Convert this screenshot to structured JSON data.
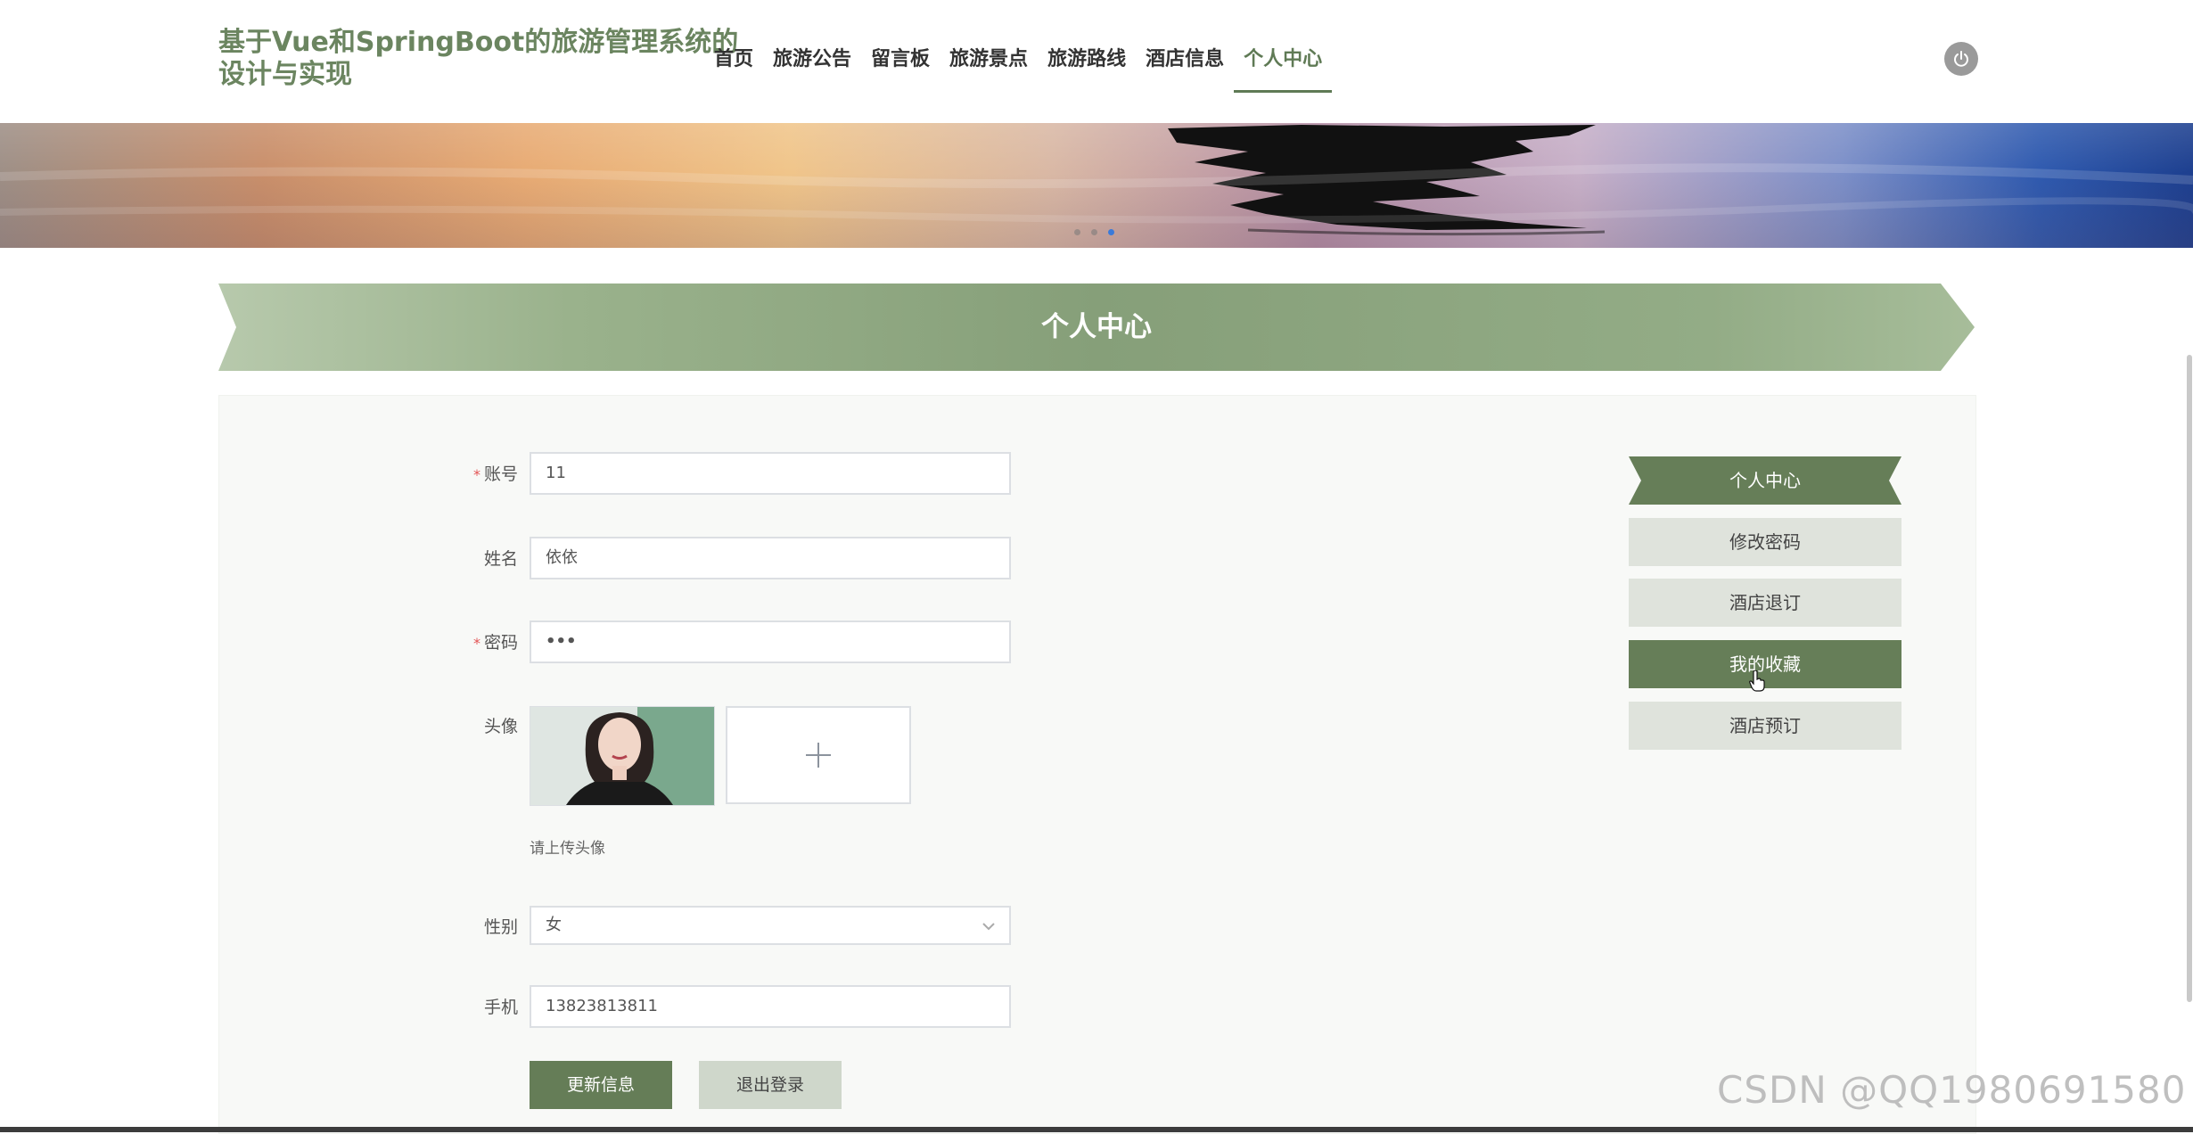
{
  "site": {
    "title": "基于Vue和SpringBoot的旅游管理系统的设计与实现"
  },
  "nav": {
    "items": [
      {
        "label": "首页"
      },
      {
        "label": "旅游公告"
      },
      {
        "label": "留言板"
      },
      {
        "label": "旅游景点"
      },
      {
        "label": "旅游路线"
      },
      {
        "label": "酒店信息"
      },
      {
        "label": "个人中心",
        "active": true
      }
    ]
  },
  "banner": {
    "slide_count": 3,
    "active_slide": 3
  },
  "section": {
    "title": "个人中心"
  },
  "form": {
    "account": {
      "label": "账号",
      "required": true,
      "value": "11"
    },
    "name": {
      "label": "姓名",
      "required": false,
      "value": "依依"
    },
    "password": {
      "label": "密码",
      "required": true,
      "value": "•••"
    },
    "avatar": {
      "label": "头像",
      "hint": "请上传头像",
      "upload_icon": "plus-icon"
    },
    "gender": {
      "label": "性别",
      "value": "女"
    },
    "phone": {
      "label": "手机",
      "value": "13823813811"
    },
    "required_mark": "*",
    "update_button": "更新信息",
    "logout_button": "退出登录"
  },
  "side_menu": {
    "items": [
      {
        "label": "个人中心",
        "style": "ribbon"
      },
      {
        "label": "修改密码"
      },
      {
        "label": "酒店退订"
      },
      {
        "label": "我的收藏",
        "selected": true
      },
      {
        "label": "酒店预订"
      }
    ]
  },
  "watermark": "CSDN @QQ1980691580",
  "colors": {
    "brand": "#657d57",
    "brand_light": "#9db48f",
    "side_item_bg": "#dfe3dc",
    "required": "#e35454"
  }
}
